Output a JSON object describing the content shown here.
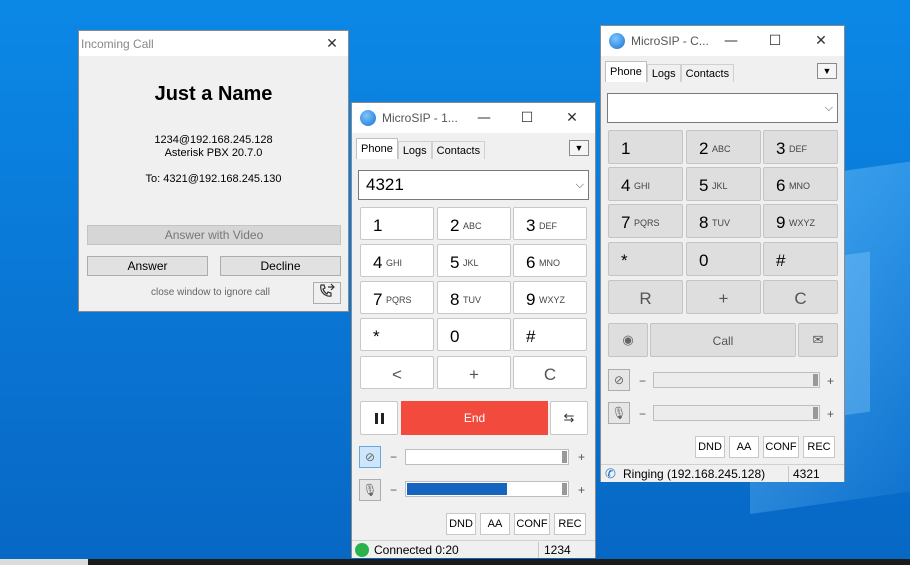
{
  "incoming": {
    "title": "Incoming Call",
    "caller_name": "Just a Name",
    "caller_uri": "1234@192.168.245.128",
    "caller_agent": "Asterisk PBX 20.7.0",
    "to_line": "To: 4321@192.168.245.130",
    "answer_video": "Answer with Video",
    "answer": "Answer",
    "decline": "Decline",
    "hint": "close window to ignore call"
  },
  "win1": {
    "title": "MicroSIP - 1...",
    "tabs": [
      "Phone",
      "Logs",
      "Contacts"
    ],
    "number": "4321",
    "end_label": "End",
    "status_text": "Connected 0:20",
    "status_account": "1234",
    "mic_level_percent": 62
  },
  "win2": {
    "title": "MicroSIP - C...",
    "tabs": [
      "Phone",
      "Logs",
      "Contacts"
    ],
    "number": "",
    "call_label": "Call",
    "status_text": "Ringing (192.168.245.128)",
    "status_account": "4321"
  },
  "keypad": {
    "k1": "1",
    "k2": "2",
    "k2l": "ABC",
    "k3": "3",
    "k3l": "DEF",
    "k4": "4",
    "k4l": "GHI",
    "k5": "5",
    "k5l": "JKL",
    "k6": "6",
    "k6l": "MNO",
    "k7": "7",
    "k7l": "PQRS",
    "k8": "8",
    "k8l": "TUV",
    "k9": "9",
    "k9l": "WXYZ",
    "star": "*",
    "k0": "0",
    "hash": "#",
    "back": "<",
    "plus": "+",
    "clear": "C",
    "redial": "R"
  },
  "controls": {
    "dnd": "DND",
    "aa": "AA",
    "conf": "CONF",
    "rec": "REC",
    "minus": "−",
    "plus": "+"
  },
  "window_buttons": {
    "minimize": "—",
    "maximize": "☐",
    "close": "✕"
  },
  "colors": {
    "end_button": "#f24a3d",
    "level_fill": "#1565c0",
    "status_green": "#2bb24c"
  }
}
